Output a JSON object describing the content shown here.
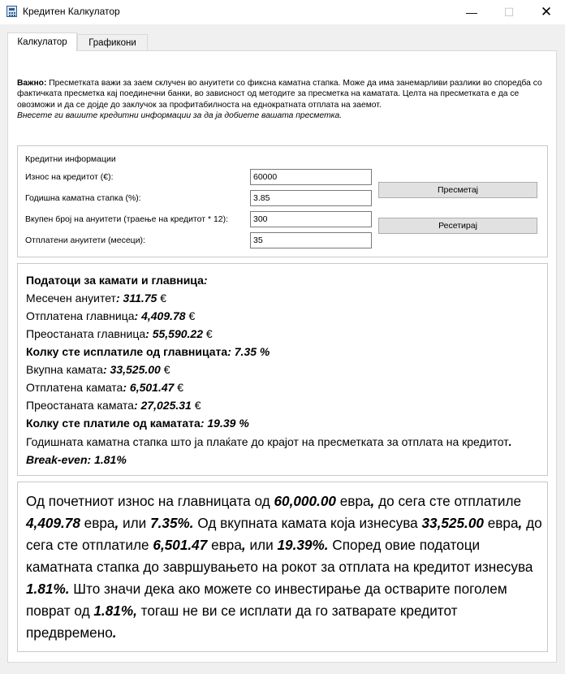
{
  "window": {
    "title": "Кредитен Калкулатор",
    "minimize": "—",
    "maximize": "☐",
    "close": "✕",
    "icon": "calculator-icon"
  },
  "tabs": [
    "Калкулатор",
    "Графикони"
  ],
  "notice": {
    "bold_prefix": "Важно:",
    "text": " Пресметката важи за заем склучен во ануитети со фиксна каматна стапка. Може да има занемарливи разлики во споредба со фактичката пресметка кај поединечни банки, во зависност од методите за пресметка на каматата. Целта на пресметката е да се овозможи и да се дојде до заклучок за профитабилноста на еднократната отплата на заемот.",
    "italic": "Внесете ги вашите кредитни информации за да ја добиете вашата пресметка."
  },
  "credit": {
    "title": "Кредитни информации",
    "amount_label": "Износ на кредитот (€):",
    "amount_value": "60000",
    "rate_label": "Годишна каматна стапка (%):",
    "rate_value": "3.85",
    "annuities_label": "Вкупен број на ануитети (траење на кредитот * 12):",
    "annuities_value": "300",
    "paid_label": "Отплатени ануитети (месеци):",
    "paid_value": "35",
    "calc_button": "Пресметај",
    "reset_button": "Ресетирај"
  },
  "results": {
    "heading": "Податоци за камати и главница",
    "colon": ":",
    "monthly_label": "Месечен ануитет",
    "monthly_value": "311.75",
    "paid_principal_label": "Отплатена главница",
    "paid_principal_value": "4,409.78",
    "remaining_principal_label": "Преостаната главница",
    "remaining_principal_value": "55,590.22",
    "principal_pct_label": "Колку сте исплатиле од главницата",
    "principal_pct_value": "7.35",
    "total_interest_label": "Вкупна камата",
    "total_interest_value": "33,525.00",
    "paid_interest_label": "Отплатена камата",
    "paid_interest_value": "6,501.47",
    "remaining_interest_label": "Преостаната камата",
    "remaining_interest_value": "27,025.31",
    "interest_pct_label": "Колку сте платиле од каматата",
    "interest_pct_value": "19.39",
    "breakeven_text": "Годишната каматна стапка што ја плаќате до крајот на пресметката за отплата на кредитот",
    "breakeven_label": "Break-even",
    "breakeven_value": "1.81",
    "euro": "€",
    "percent": "%"
  },
  "summary": {
    "s1": "Од почетниот износ на главницата од ",
    "v1": "60,000.00",
    "s2": " евра",
    "s3": " до сега сте отплатиле ",
    "v2": "4,409.78",
    "s4": " евра",
    "s5": " или ",
    "v3": "7.35%.",
    "s6": " Од вкупната камата која изнесува ",
    "v4": "33,525.00",
    "s7": " евра",
    "s8": " до сега сте отплатиле ",
    "v5": "6,501.47",
    "s9": " евра",
    "s10": " или ",
    "v6": "19.39%.",
    "s11": " Според овие податоци каматната стапка до завршувањето на рокот за отплата на кредитот изнесува ",
    "v7": "1.81%.",
    "s12": " Што значи дека ако можете со инвестирање да остварите поголем поврат од ",
    "v8": "1.81%,",
    "s13": " тогаш не ви се исплати да го затварате кредитот предвремено",
    "comma": ",",
    "period": "."
  }
}
